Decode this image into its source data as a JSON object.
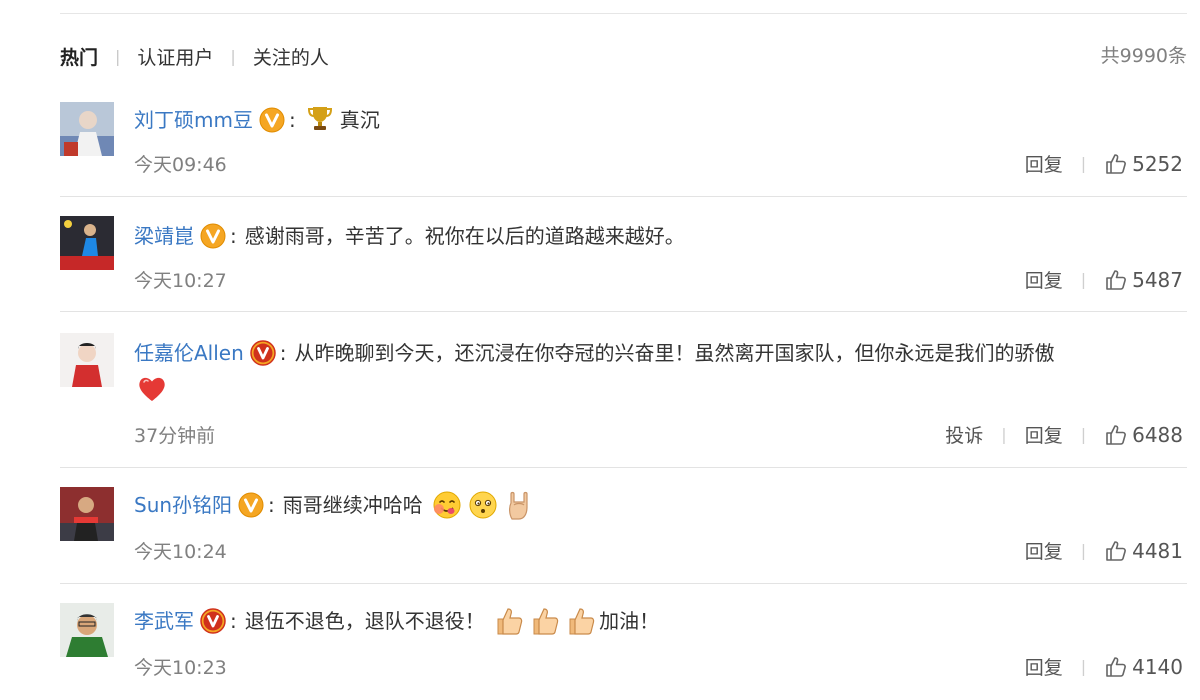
{
  "tabs": [
    {
      "label": "热门",
      "active": true
    },
    {
      "label": "认证用户",
      "active": false
    },
    {
      "label": "关注的人",
      "active": false
    }
  ],
  "total_label": "共9990条",
  "colors": {
    "username": "#3a78c3",
    "badge": "#f5a623",
    "badge_alt": "#d0311c",
    "meta": "#808080"
  },
  "comments": [
    {
      "name": "刘丁硕mm豆",
      "badge": "yellow-v",
      "text": "真沉",
      "emoji_before": [
        "trophy-icon"
      ],
      "emoji_after": [],
      "time": "今天09:46",
      "report": "",
      "reply": "回复",
      "likes": "5252"
    },
    {
      "name": "梁靖崑",
      "badge": "yellow-v",
      "text": "感谢雨哥，辛苦了。祝你在以后的道路越来越好。",
      "emoji_before": [],
      "emoji_after": [],
      "time": "今天10:27",
      "report": "",
      "reply": "回复",
      "likes": "5487"
    },
    {
      "name": "任嘉伦Allen",
      "badge": "red-v",
      "text": "从昨晚聊到今天，还沉浸在你夺冠的兴奋里！虽然离开国家队，但你永远是我们的骄傲",
      "emoji_before": [],
      "emoji_after": [
        "heart-icon"
      ],
      "time": "37分钟前",
      "report": "投诉",
      "reply": "回复",
      "likes": "6488"
    },
    {
      "name": "Sun孙铭阳",
      "badge": "yellow-v",
      "text": "雨哥继续冲哈哈",
      "emoji_before": [],
      "emoji_after": [
        "yummy-face-icon",
        "thinking-face-icon",
        "rock-hand-icon"
      ],
      "time": "今天10:24",
      "report": "",
      "reply": "回复",
      "likes": "4481"
    },
    {
      "name": "李武军",
      "badge": "red-v",
      "text": "退伍不退色，退队不退役！",
      "emoji_before": [],
      "emoji_after": [
        "thumbs-up-icon",
        "thumbs-up-icon",
        "thumbs-up-icon"
      ],
      "text2": "加油！",
      "time": "今天10:23",
      "report": "",
      "reply": "回复",
      "likes": "4140"
    }
  ]
}
